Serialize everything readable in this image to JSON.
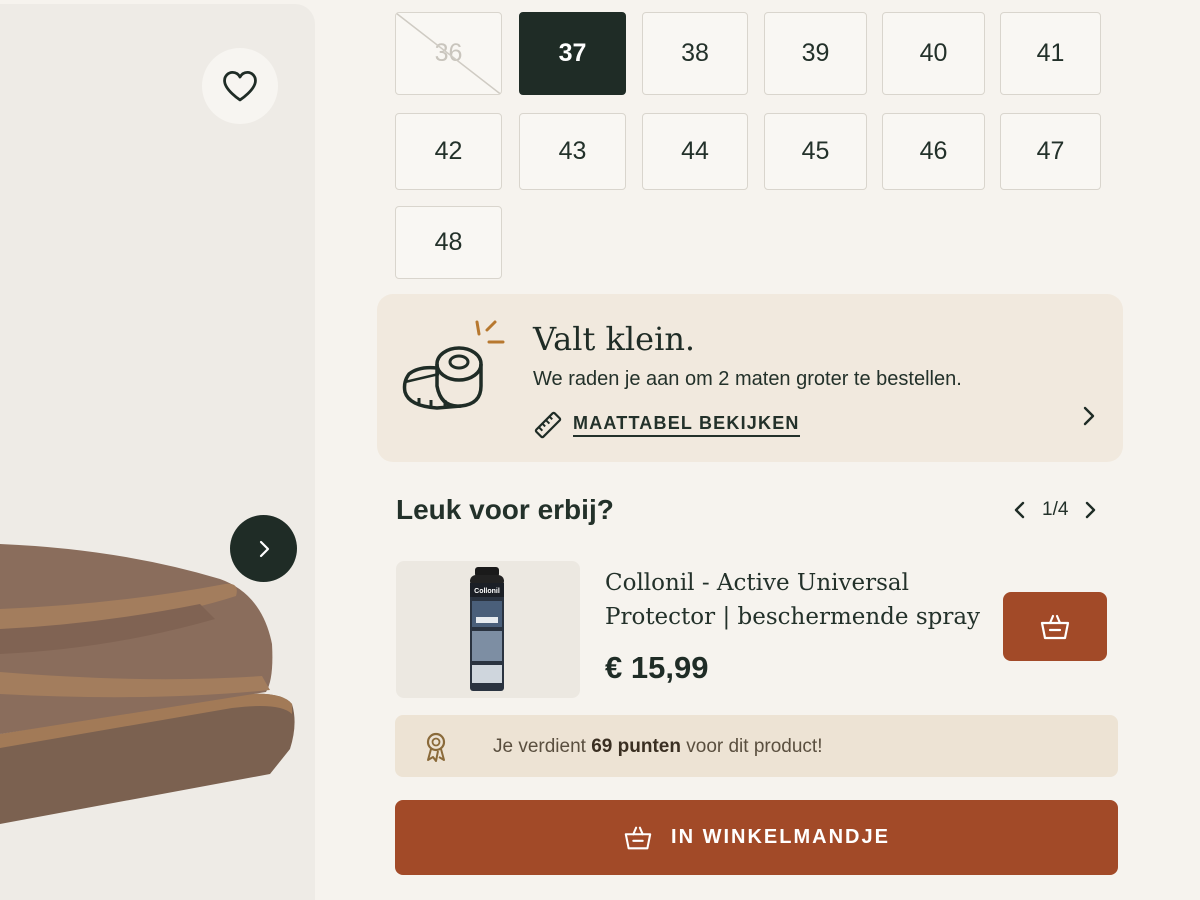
{
  "colors": {
    "accent": "#a24a28",
    "dark": "#1f2c26",
    "fit_card_bg": "#f1e9de",
    "points_bar_bg": "#ede3d4",
    "page_bg": "#f6f3ee"
  },
  "gallery": {
    "favorite_icon": "heart-icon",
    "next_icon": "chevron-right-icon"
  },
  "sizes": [
    {
      "label": "36",
      "state": "unavailable"
    },
    {
      "label": "37",
      "state": "selected"
    },
    {
      "label": "38",
      "state": "available"
    },
    {
      "label": "39",
      "state": "available"
    },
    {
      "label": "40",
      "state": "available"
    },
    {
      "label": "41",
      "state": "available"
    },
    {
      "label": "42",
      "state": "available"
    },
    {
      "label": "43",
      "state": "available"
    },
    {
      "label": "44",
      "state": "available"
    },
    {
      "label": "45",
      "state": "available"
    },
    {
      "label": "46",
      "state": "available"
    },
    {
      "label": "47",
      "state": "available"
    },
    {
      "label": "48",
      "state": "available"
    }
  ],
  "fit_advice": {
    "icon": "measuring-tape-icon",
    "title": "Valt klein.",
    "text": "We raden je aan om 2 maten groter te bestellen.",
    "link_icon": "ruler-icon",
    "link_label": "MAATTABEL BEKIJKEN"
  },
  "recommendations": {
    "heading": "Leuk voor erbij?",
    "pager": "1/4",
    "item": {
      "name_line1": "Collonil - Active Universal",
      "name_line2": "Protector | beschermende spray",
      "price": "€ 15,99",
      "thumb_brand": "Collonil",
      "add_icon": "basket-icon"
    }
  },
  "points": {
    "icon": "award-ribbon-icon",
    "prefix": "Je verdient ",
    "amount": "69 punten",
    "suffix": " voor dit product!"
  },
  "cart": {
    "icon": "basket-icon",
    "label": "IN WINKELMANDJE"
  }
}
